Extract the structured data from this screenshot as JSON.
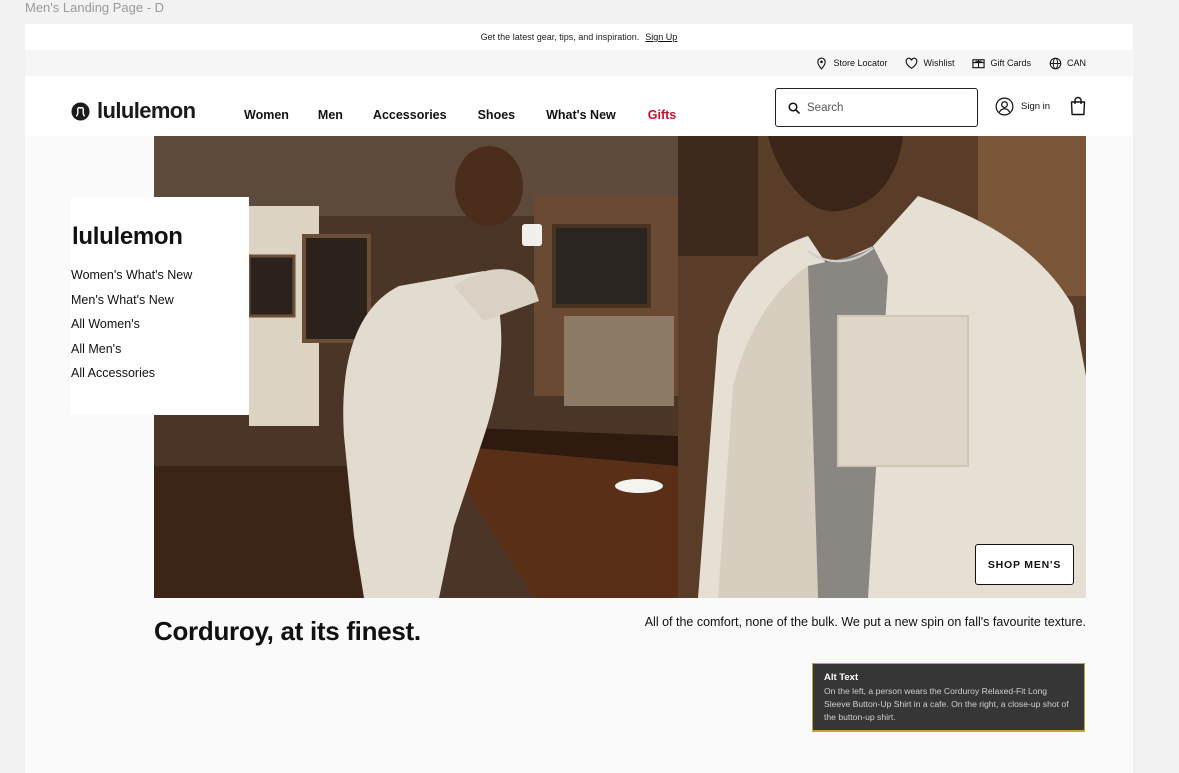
{
  "frame": {
    "label": "Men's Landing Page - D"
  },
  "promo": {
    "text": "Get the latest gear, tips, and inspiration.",
    "link": "Sign Up"
  },
  "utility": {
    "store_locator": "Store Locator",
    "wishlist": "Wishlist",
    "gift_cards": "Gift Cards",
    "region": "CAN"
  },
  "brand": {
    "name": "lululemon"
  },
  "nav": {
    "items": [
      "Women",
      "Men",
      "Accessories",
      "Shoes",
      "What's New",
      "Gifts"
    ],
    "gifts_color": "#c8102e"
  },
  "search": {
    "placeholder": "Search"
  },
  "account": {
    "signin": "Sign in"
  },
  "side_panel": {
    "title": "lululemon",
    "links": [
      "Women's What's New",
      "Men's What's New",
      "All Women's",
      "All Men's",
      "All Accessories"
    ]
  },
  "hero": {
    "cta": "SHOP MEN'S",
    "headline": "Corduroy, at its finest.",
    "subcopy": "All of the comfort, none of the bulk. We put a new spin on fall's favourite texture."
  },
  "alt_text": {
    "title": "Alt Text",
    "body": "On the left, a person wears the Corduroy Relaxed-Fit Long Sleeve Button-Up Shirt in a cafe. On the right, a close-up shot of the button-up shirt."
  }
}
